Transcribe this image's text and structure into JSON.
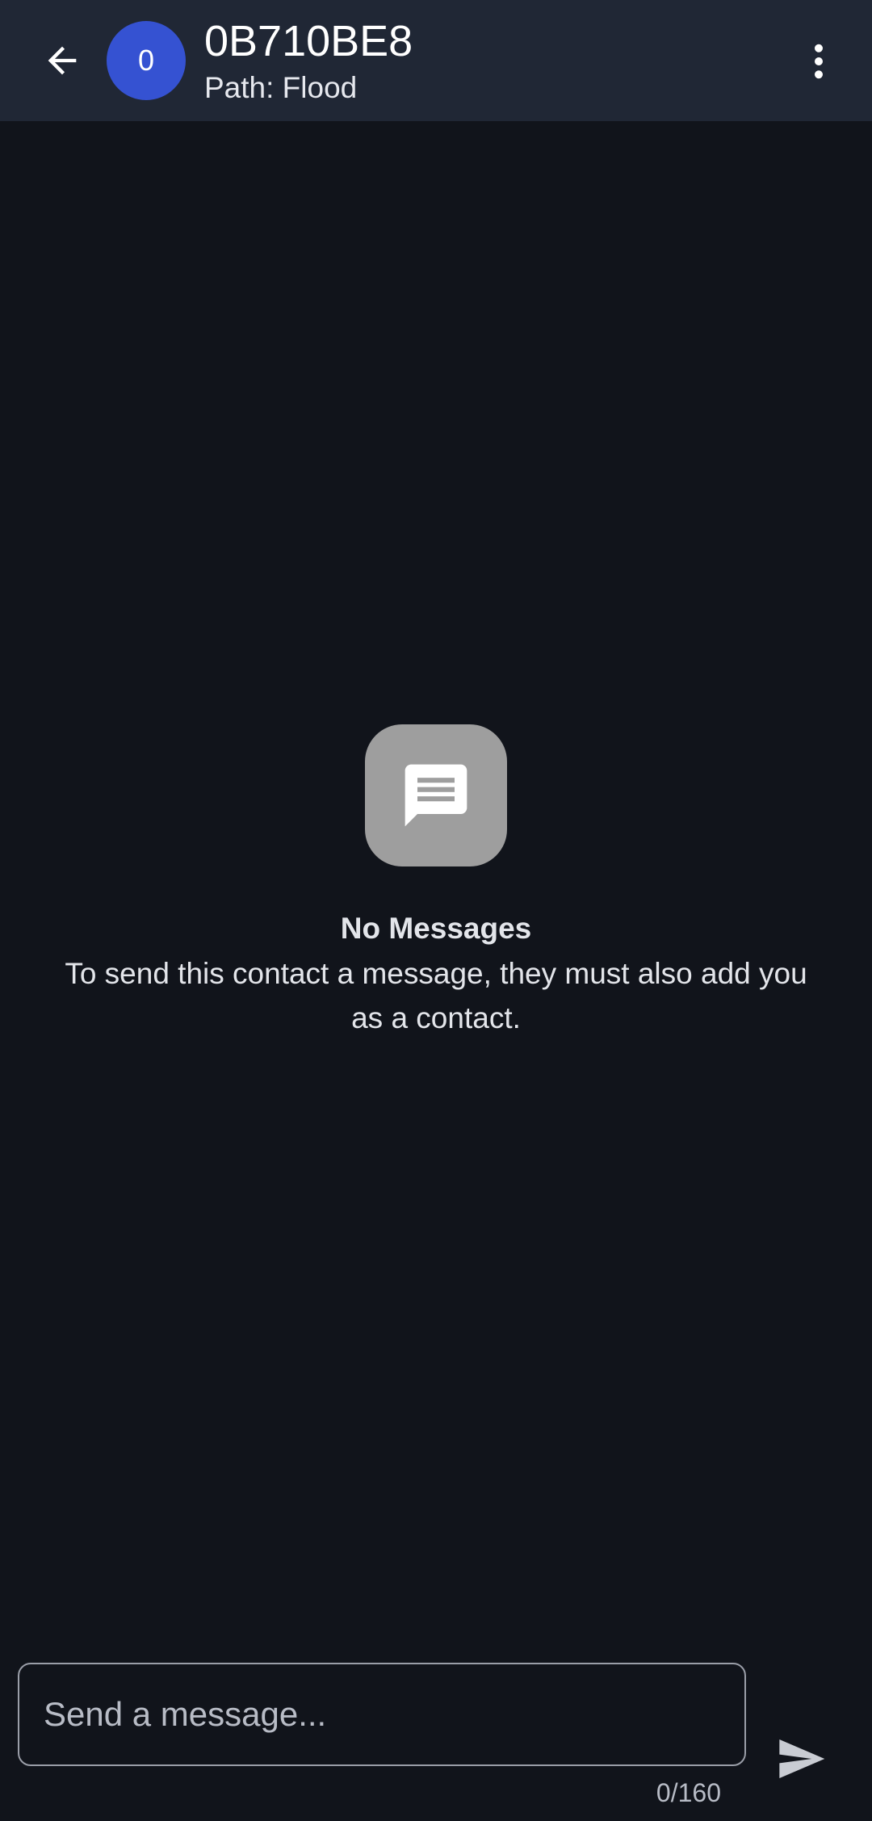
{
  "colors": {
    "header_bg": "#202735",
    "screen_bg": "#11141b",
    "avatar_bg": "#3552d2",
    "icon_tile_bg": "#9e9e9e",
    "text_primary": "#ffffff",
    "text_secondary": "#e3e5ea",
    "input_border": "#9a9ea8"
  },
  "header": {
    "back_icon": "arrow-left-icon",
    "avatar_initial": "0",
    "contact_name": "0B710BE8",
    "path_label": "Path: Flood",
    "more_icon": "more-vertical-icon"
  },
  "empty_state": {
    "icon": "message-bubble-icon",
    "title": "No Messages",
    "description": "To send this contact a message, they must also add you as a contact."
  },
  "composer": {
    "placeholder": "Send a message...",
    "value": "",
    "counter": "0/160",
    "send_icon": "send-icon"
  }
}
